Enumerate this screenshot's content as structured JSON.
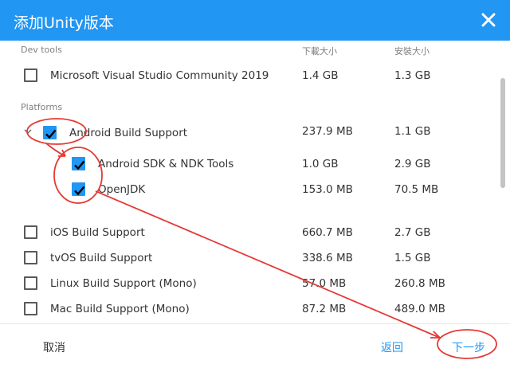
{
  "dialog": {
    "title": "添加Unity版本"
  },
  "columns": {
    "download_size": "下載大小",
    "install_size": "安裝大小"
  },
  "sections": {
    "dev_tools": "Dev tools",
    "platforms": "Platforms"
  },
  "modules": [
    {
      "label": "Microsoft Visual Studio Community 2019",
      "download": "1.4 GB",
      "install": "1.3 GB",
      "checked": false
    },
    {
      "label": "Android Build Support",
      "download": "237.9 MB",
      "install": "1.1 GB",
      "checked": true
    },
    {
      "label": "Android SDK & NDK Tools",
      "download": "1.0 GB",
      "install": "2.9 GB",
      "checked": true
    },
    {
      "label": "OpenJDK",
      "download": "153.0 MB",
      "install": "70.5 MB",
      "checked": true
    },
    {
      "label": "iOS Build Support",
      "download": "660.7 MB",
      "install": "2.7 GB",
      "checked": false
    },
    {
      "label": "tvOS Build Support",
      "download": "338.6 MB",
      "install": "1.5 GB",
      "checked": false
    },
    {
      "label": "Linux Build Support (Mono)",
      "download": "57.0 MB",
      "install": "260.8 MB",
      "checked": false
    },
    {
      "label": "Mac Build Support (Mono)",
      "download": "87.2 MB",
      "install": "489.0 MB",
      "checked": false
    }
  ],
  "footer": {
    "cancel": "取消",
    "back": "返回",
    "next": "下一步"
  },
  "colors": {
    "accent": "#2196F3",
    "annotation": "#e53935"
  },
  "icons": {
    "close": "close-icon",
    "check": "check-icon",
    "expand": "chevron-down-icon"
  }
}
